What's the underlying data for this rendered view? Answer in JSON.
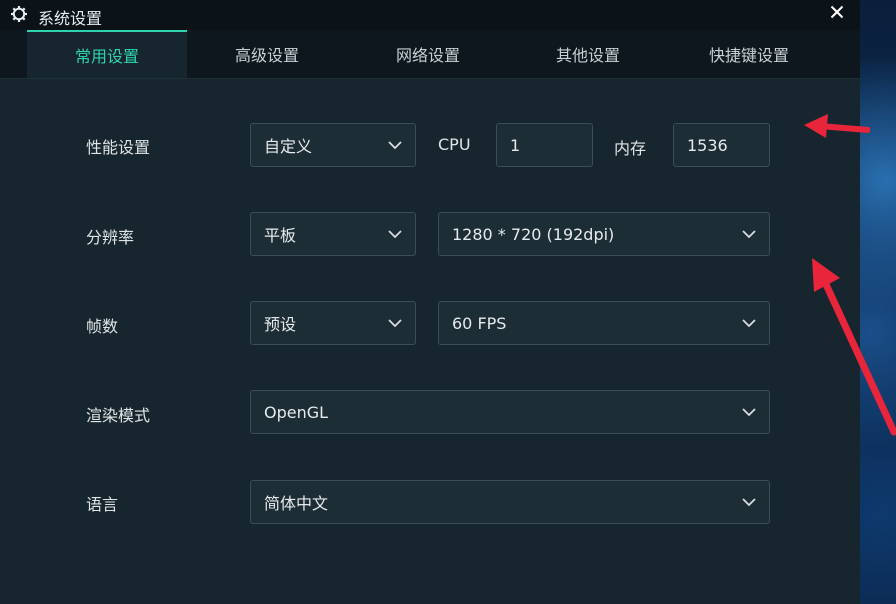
{
  "window": {
    "title": "系统设置",
    "icons": {
      "settings": "gear-icon",
      "close": "close-icon"
    }
  },
  "tabs": [
    {
      "label": "常用设置",
      "active": true
    },
    {
      "label": "高级设置",
      "active": false
    },
    {
      "label": "网络设置",
      "active": false
    },
    {
      "label": "其他设置",
      "active": false
    },
    {
      "label": "快捷键设置",
      "active": false
    }
  ],
  "settings": {
    "performance": {
      "label": "性能设置",
      "mode": "自定义",
      "cpu_label": "CPU",
      "cpu_value": "1",
      "memory_label": "内存",
      "memory_value": "1536"
    },
    "resolution": {
      "label": "分辨率",
      "type": "平板",
      "value": "1280 * 720 (192dpi)"
    },
    "framerate": {
      "label": "帧数",
      "mode": "预设",
      "value": "60 FPS"
    },
    "render": {
      "label": "渲染模式",
      "value": "OpenGL"
    },
    "language": {
      "label": "语言",
      "value": "简体中文"
    }
  },
  "colors": {
    "accent": "#2ed3b0",
    "window_bg": "#17262e",
    "control_bg": "#1d2d36",
    "annotation_arrow": "#e8253a"
  }
}
